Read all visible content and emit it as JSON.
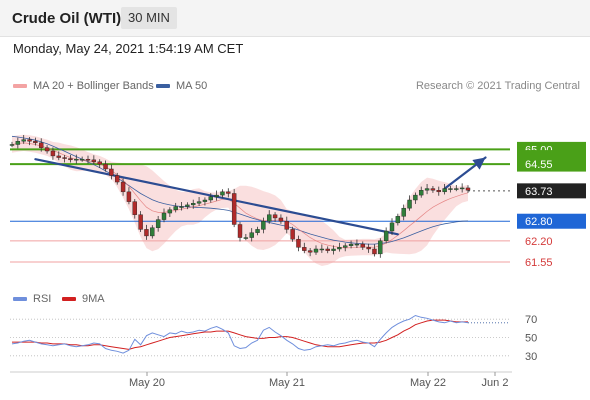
{
  "header": {
    "title": "Crude Oil (WTI)",
    "timeframe": "30 MIN"
  },
  "date_text": "Monday, May 24, 2021 1:54:19 AM CET",
  "legend": {
    "ma20_label": "MA 20 + Bollinger Bands",
    "ma50_label": "MA 50",
    "rsi_label": "RSI",
    "rsi_ma_label": "9MA"
  },
  "credit": "Research © 2021 Trading Central",
  "colors": {
    "resistance": "#4aa018",
    "support": "#1f66d6",
    "support_minor": "#f0a0a0",
    "last": "#222222",
    "ma20_band": "#f6c5c5",
    "ma50": "#3a5fa0",
    "rsi": "#6f8fdc",
    "rsi_ma": "#d22020",
    "trend": "#2c4c92"
  },
  "levels": [
    {
      "value": 65.0,
      "label": "65.00",
      "kind": "resistance"
    },
    {
      "value": 64.55,
      "label": "64.55",
      "kind": "resistance"
    },
    {
      "value": 63.73,
      "label": "63.73",
      "kind": "last"
    },
    {
      "value": 62.8,
      "label": "62.80",
      "kind": "support"
    },
    {
      "value": 62.2,
      "label": "62.20",
      "kind": "support_minor"
    },
    {
      "value": 61.55,
      "label": "61.55",
      "kind": "support_minor"
    }
  ],
  "chart_data": {
    "type": "line",
    "title": "Crude Oil (WTI)",
    "timeframe": "30 MIN",
    "x_tick_labels": [
      "May 20",
      "May 21",
      "May 22",
      "Jun 2"
    ],
    "price_axis_labels": [
      "65.00",
      "64.55",
      "63.73",
      "62.80",
      "62.20",
      "61.55"
    ],
    "rsi_axis_labels": [
      "70",
      "50",
      "30"
    ],
    "ylim": [
      61.0,
      65.9
    ],
    "rsi_ylim": [
      20,
      80
    ],
    "price_close": [
      65.15,
      65.25,
      65.3,
      65.25,
      65.2,
      65.05,
      64.95,
      64.8,
      64.75,
      64.72,
      64.68,
      64.7,
      64.7,
      64.68,
      64.62,
      64.55,
      64.4,
      64.2,
      64.0,
      63.7,
      63.4,
      63.0,
      62.55,
      62.35,
      62.6,
      62.85,
      63.05,
      63.15,
      63.25,
      63.25,
      63.3,
      63.35,
      63.4,
      63.45,
      63.55,
      63.6,
      63.7,
      63.65,
      62.7,
      62.3,
      62.3,
      62.45,
      62.55,
      62.8,
      63.0,
      62.9,
      62.8,
      62.55,
      62.25,
      62.0,
      61.9,
      61.85,
      61.95,
      61.95,
      61.9,
      61.95,
      62.0,
      62.05,
      62.1,
      62.1,
      62.0,
      61.95,
      61.8,
      62.2,
      62.5,
      62.75,
      62.95,
      63.2,
      63.45,
      63.6,
      63.75,
      63.8,
      63.75,
      63.7,
      63.8,
      63.8,
      63.8,
      63.82,
      63.75
    ],
    "ma20": [
      65.15,
      65.18,
      65.2,
      65.18,
      65.15,
      65.1,
      65.05,
      64.97,
      64.9,
      64.82,
      64.75,
      64.7,
      64.67,
      64.64,
      64.6,
      64.55,
      64.47,
      64.36,
      64.22,
      64.05,
      63.87,
      63.65,
      63.43,
      63.23,
      63.12,
      63.07,
      63.07,
      63.1,
      63.13,
      63.17,
      63.2,
      63.24,
      63.28,
      63.32,
      63.37,
      63.42,
      63.47,
      63.47,
      63.35,
      63.2,
      63.05,
      62.95,
      62.87,
      62.82,
      62.82,
      62.83,
      62.84,
      62.8,
      62.7,
      62.56,
      62.43,
      62.3,
      62.2,
      62.12,
      62.07,
      62.03,
      62.0,
      61.98,
      61.99,
      62.0,
      62.01,
      62.01,
      62.0,
      62.05,
      62.13,
      62.24,
      62.37,
      62.51,
      62.66,
      62.8,
      62.95,
      63.1,
      63.23,
      63.33,
      63.42,
      63.5,
      63.56,
      63.62,
      63.67
    ],
    "ma50": [
      65.4,
      65.38,
      65.35,
      65.32,
      65.28,
      65.23,
      65.17,
      65.1,
      65.02,
      64.94,
      64.86,
      64.78,
      64.7,
      64.62,
      64.53,
      64.44,
      64.34,
      64.24,
      64.13,
      64.01,
      63.89,
      63.77,
      63.65,
      63.55,
      63.46,
      63.39,
      63.34,
      63.3,
      63.27,
      63.25,
      63.24,
      63.23,
      63.22,
      63.21,
      63.2,
      63.18,
      63.16,
      63.13,
      63.08,
      63.02,
      62.96,
      62.9,
      62.85,
      62.8,
      62.76,
      62.72,
      62.68,
      62.64,
      62.59,
      62.53,
      62.47,
      62.41,
      62.36,
      62.31,
      62.26,
      62.22,
      62.19,
      62.16,
      62.14,
      62.12,
      62.11,
      62.1,
      62.1,
      62.12,
      62.14,
      62.18,
      62.23,
      62.29,
      62.36,
      62.43,
      62.5,
      62.57,
      62.63,
      62.68,
      62.72,
      62.75,
      62.78,
      62.8,
      62.81
    ],
    "rsi": [
      43,
      44,
      46,
      47,
      45,
      43,
      42,
      41,
      42,
      43,
      41,
      40,
      41,
      42,
      44,
      43,
      38,
      36,
      35,
      33,
      36,
      48,
      42,
      52,
      55,
      53,
      51,
      55,
      54,
      57,
      55,
      56,
      58,
      57,
      60,
      62,
      59,
      55,
      41,
      38,
      39,
      44,
      47,
      58,
      61,
      56,
      52,
      47,
      43,
      38,
      36,
      37,
      40,
      41,
      42,
      41,
      43,
      44,
      46,
      47,
      45,
      44,
      40,
      48,
      55,
      61,
      65,
      68,
      70,
      74,
      72,
      71,
      69,
      67,
      66,
      68,
      66,
      67,
      66
    ],
    "rsi_ma": [
      45,
      45,
      45,
      45,
      45,
      44,
      44,
      43,
      43,
      43,
      42,
      42,
      41,
      41,
      42,
      42,
      41,
      40,
      39,
      38,
      37,
      39,
      40,
      42,
      44,
      46,
      48,
      50,
      51,
      52,
      53,
      54,
      55,
      56,
      56,
      57,
      57,
      57,
      55,
      53,
      51,
      50,
      49,
      49,
      50,
      50,
      51,
      51,
      50,
      48,
      46,
      44,
      42,
      41,
      40,
      40,
      40,
      41,
      42,
      43,
      44,
      44,
      44,
      45,
      47,
      50,
      53,
      57,
      60,
      64,
      66,
      68,
      69,
      69,
      69,
      68,
      67,
      67,
      67
    ],
    "trendlines": [
      {
        "name": "falling resistance",
        "from": [
          4,
          64.7
        ],
        "to": [
          66,
          62.4
        ]
      },
      {
        "name": "projection",
        "from": [
          74,
          63.8
        ],
        "to": [
          81,
          64.75
        ]
      }
    ]
  }
}
